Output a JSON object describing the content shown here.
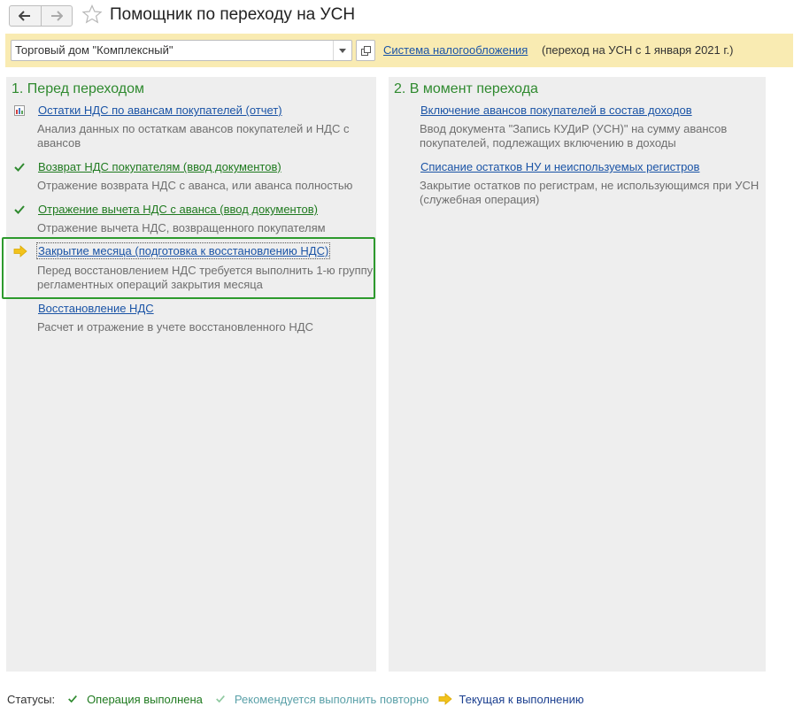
{
  "window": {
    "title": "Помощник по переходу на УСН"
  },
  "toolbar": {
    "organization": "Торговый дом \"Комплексный\"",
    "tax_system_link": "Система налогообложения",
    "transition_note": "(переход на УСН с 1 января 2021 г.)"
  },
  "left_panel": {
    "title": "1. Перед переходом",
    "items": [
      {
        "label": "Остатки НДС по авансам покупателей (отчет)",
        "status": "report",
        "description_lines": [
          "Анализ данных по остаткам авансов покупателей и НДС с",
          "авансов"
        ]
      },
      {
        "label": "Возврат НДС покупателям (ввод документов)",
        "status": "done",
        "description_lines": [
          "Отражение возврата НДС с аванса, или аванса полностью"
        ]
      },
      {
        "label": "Отражение вычета НДС с аванса (ввод документов)",
        "status": "done",
        "description_lines": [
          "Отражение вычета НДС, возвращенного покупателям"
        ]
      },
      {
        "label": "Закрытие месяца (подготовка к восстановлению НДС)",
        "status": "current",
        "description_lines": [
          "Перед восстановлением НДС требуется выполнить 1-ю группу",
          "регламентных операций закрытия месяца"
        ]
      },
      {
        "label": "Восстановление НДС",
        "status": "none",
        "description_lines": [
          "Расчет и отражение в учете восстановленного НДС"
        ]
      }
    ]
  },
  "right_panel": {
    "title": "2. В момент перехода",
    "items": [
      {
        "label": "Включение авансов покупателей в состав доходов",
        "description_lines": [
          "Ввод документа \"Запись КУДиР (УСН)\" на сумму авансов",
          "покупателей, подлежащих включению в доходы"
        ]
      },
      {
        "label": "Списание остатков НУ и неиспользуемых регистров",
        "description_lines": [
          "Закрытие остатков по  регистрам, не использующимся при УСН",
          "(служебная операция)"
        ]
      }
    ]
  },
  "legend": {
    "label": "Статусы:",
    "done": "Операция выполнена",
    "retry": "Рекомендуется выполнить повторно",
    "current": "Текущая к выполнению"
  },
  "colors": {
    "accent_green": "#2f8a2f",
    "link_blue": "#1b54a6",
    "topbar_yellow": "#f9ebb2",
    "highlight_border": "#2d9a2d",
    "current_arrow": "#f2c21b"
  }
}
